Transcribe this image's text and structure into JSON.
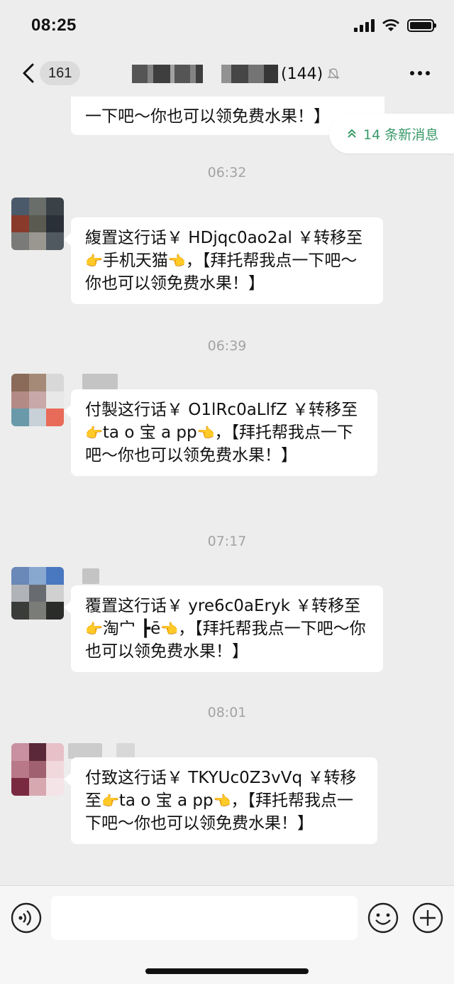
{
  "status_bar": {
    "time": "08:25"
  },
  "nav": {
    "back_count": "161",
    "group_member_count": "(144)"
  },
  "new_messages_pill": "14 条新消息",
  "messages": [
    {
      "text": "一下吧～你也可以领免费水果！】"
    },
    {
      "timestamp": "06:32"
    },
    {
      "parts": [
        "緮置这行话￥ HDjqc0ao2al ￥转移至",
        "👉",
        "手机天猫",
        "👈",
        "，【拜托帮我点一下吧～你也可以领免费水果！】"
      ]
    },
    {
      "timestamp": "06:39"
    },
    {
      "parts": [
        "付製这行话￥ O1lRc0aLlfZ ￥转移至",
        "👉",
        "ta o 宝 a pp",
        "👈",
        "，【拜托帮我点一下吧～你也可以领免费水果！】"
      ]
    },
    {
      "timestamp": "07:17"
    },
    {
      "parts": [
        "覆置这行话￥ yre6c0aEryk ￥转移至",
        "👉",
        "淘宀 ┣ē",
        "👈",
        "，【拜托帮我点一下吧～你也可以领免费水果！】"
      ]
    },
    {
      "timestamp": "08:01"
    },
    {
      "parts": [
        "付致这行话￥ TKYUc0Z3vVq ￥转移至",
        "👉",
        "ta o 宝 a pp",
        "👈",
        "，【拜托帮我点一下吧～你也可以领免费水果！】"
      ]
    }
  ],
  "input": {
    "placeholder": ""
  },
  "icons": {
    "back": "chevron-left-icon",
    "more": "more-dots-icon",
    "mute": "bell-muted-icon",
    "voice": "voice-icon",
    "emoji": "emoji-icon",
    "plus": "plus-icon"
  },
  "colors": {
    "accent_green": "#3a9a6a",
    "background": "#ededed",
    "bubble": "#ffffff"
  }
}
